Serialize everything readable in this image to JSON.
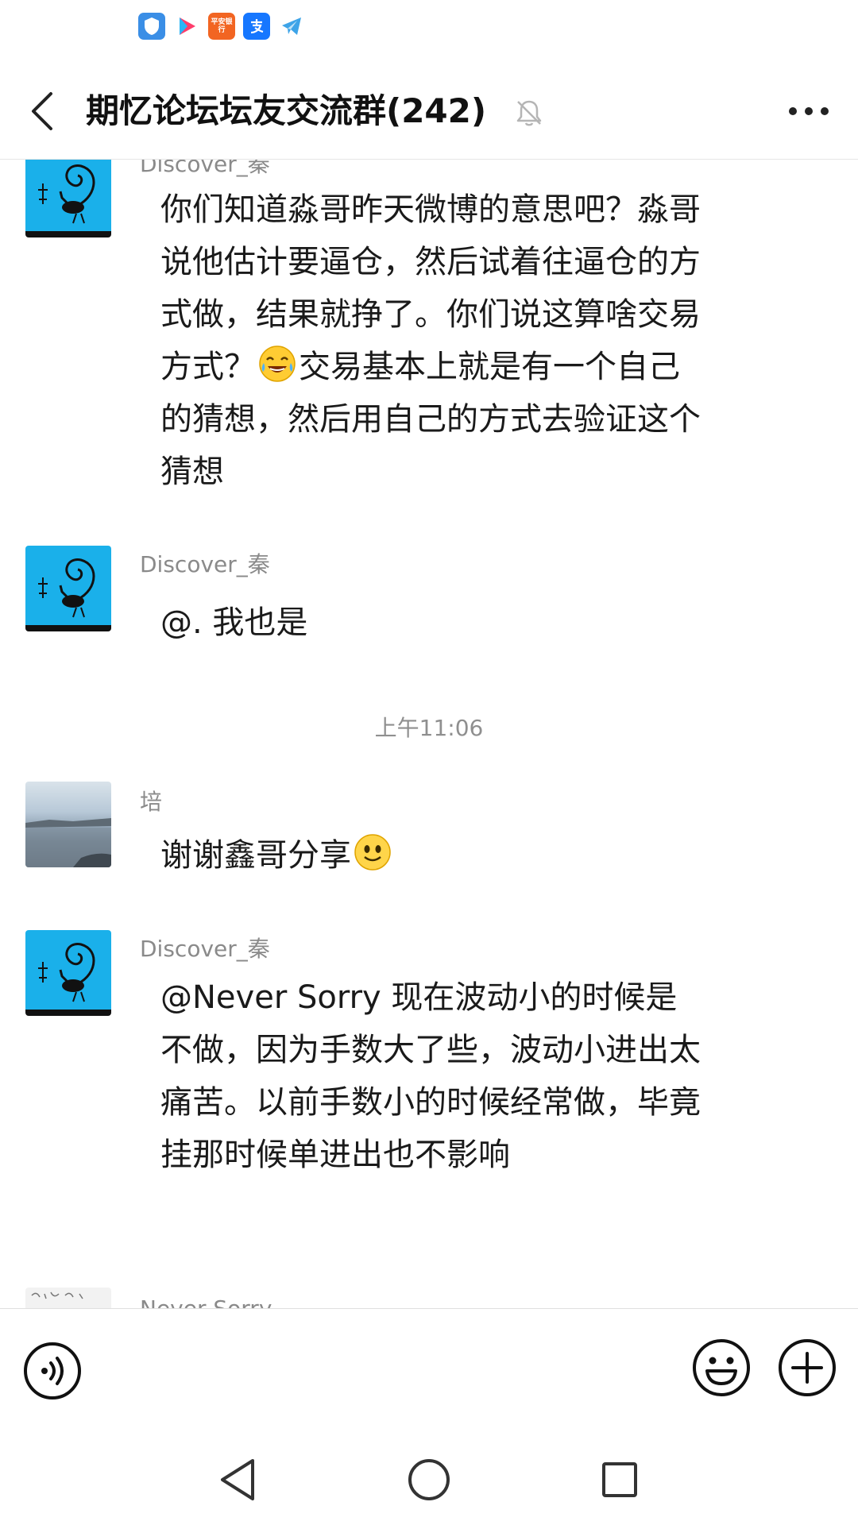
{
  "status_bar": {
    "icons": [
      "shield-app-icon",
      "play-app-icon",
      "bank-app-icon",
      "alipay-icon",
      "telegram-icon"
    ],
    "bank_icon_text": "平安银行"
  },
  "header": {
    "title": "期忆论坛坛友交流群(242)",
    "muted": true
  },
  "messages": [
    {
      "sender": "Discover_秦",
      "text_parts": [
        "你们知道淼哥昨天微博的意思吧？淼哥说他估计要逼仓，然后试着往逼仓的方式做，结果就挣了。你们说这算啥交易方式？",
        "交易基本上就是有一个自己的猜想，然后用自己的方式去验证这个猜想"
      ],
      "emoji": "laughing-tears-emoji"
    },
    {
      "sender": "Discover_秦",
      "text": "@.  我也是"
    },
    {
      "sender": "培",
      "text": "谢谢鑫哥分享",
      "emoji": "smile-emoji"
    },
    {
      "sender": "Discover_秦",
      "text": "@Never Sorry  现在波动小的时候是不做，因为手数大了些，波动小进出太痛苦。以前手数小的时候经常做，毕竟挂那时候单进出也不影响"
    },
    {
      "sender": "Never Sorry"
    }
  ],
  "timestamp": "上午11:06",
  "colors": {
    "avatar_blue": "#1ab0ea",
    "text": "#1a1a1a",
    "meta": "#8a8a8a"
  }
}
